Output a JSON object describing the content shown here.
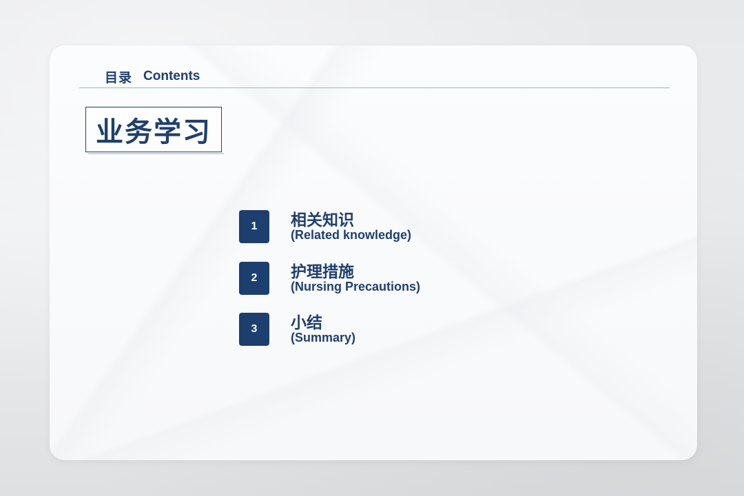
{
  "header": {
    "title_cn": "目录",
    "title_en": "Contents"
  },
  "section": {
    "title": "业务学习"
  },
  "toc": {
    "items": [
      {
        "number": "1",
        "title_cn": "相关知识",
        "title_en": "(Related knowledge)"
      },
      {
        "number": "2",
        "title_cn": "护理措施",
        "title_en": "(Nursing Precautions)"
      },
      {
        "number": "3",
        "title_cn": "小结",
        "title_en": "(Summary)"
      }
    ]
  },
  "colors": {
    "primary": "#1f3f6e",
    "divider": "#7fc6c0",
    "card": "#f7f8fa"
  }
}
